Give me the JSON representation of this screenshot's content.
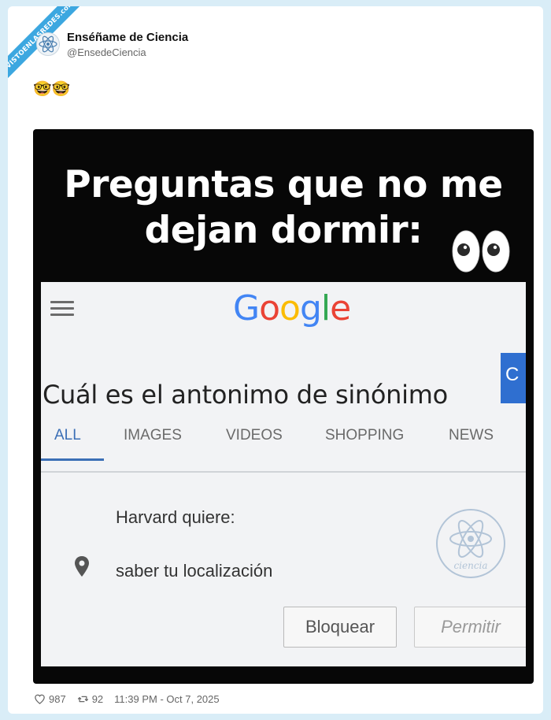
{
  "watermark_site": "VISTOENLASREDES",
  "watermark_tld": ".com",
  "tweet": {
    "author_name": "Enséñame de Ciencia",
    "author_handle": "@EnsedeCiencia",
    "text_emoji": "🤓🤓",
    "likes": "987",
    "retweets": "92",
    "timestamp": "11:39 PM - Oct 7, 2025"
  },
  "meme": {
    "headline_line1": "Preguntas que no me",
    "headline_line2": "dejan dormir:",
    "eyes_emoji": "eyes-icon"
  },
  "search_screenshot": {
    "logo_letters": [
      "G",
      "o",
      "o",
      "g",
      "l",
      "e"
    ],
    "logo_colors": [
      "#4285F4",
      "#EA4335",
      "#FBBC05",
      "#4285F4",
      "#34A853",
      "#EA4335"
    ],
    "blue_button_text": "C",
    "query": "Cuál es el antonimo de sinónimo",
    "tabs": [
      "ALL",
      "IMAGES",
      "VIDEOS",
      "SHOPPING",
      "NEWS"
    ],
    "active_tab": "ALL",
    "permission_title": "Harvard quiere:",
    "permission_item": "saber tu localización",
    "block_button": "Bloquear",
    "allow_button": "Permitir",
    "stamp_text": "ciencia"
  },
  "colors": {
    "page_bg": "#d9edf7",
    "ribbon": "#3ca7e0",
    "meme_bg": "#070707",
    "tab_accent": "#3b6fb6"
  }
}
